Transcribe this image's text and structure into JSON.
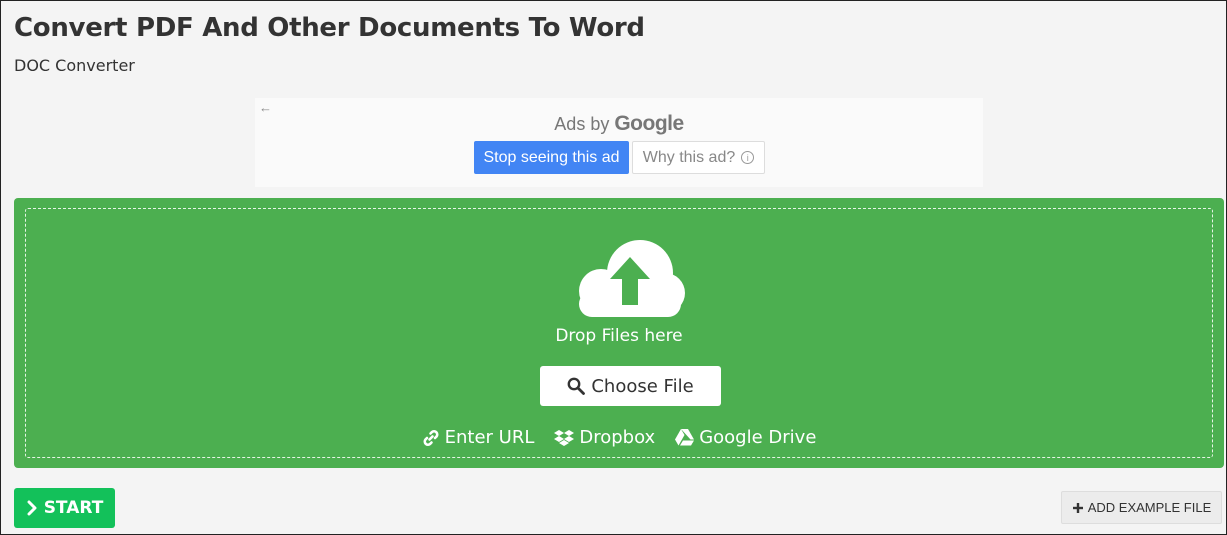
{
  "header": {
    "title": "Convert PDF And Other Documents To Word",
    "subtitle": "DOC Converter"
  },
  "ad": {
    "back_icon": "arrow-left-icon",
    "ads_by": "Ads by",
    "google": "Google",
    "stop_label": "Stop seeing this ad",
    "why_label": "Why this ad?",
    "stop_color": "#4285f4"
  },
  "dropzone": {
    "color": "#4caf50",
    "upload_icon": "cloud-upload-icon",
    "drop_text": "Drop Files here",
    "choose_label": "Choose File",
    "sources": [
      {
        "icon": "link-icon",
        "label": "Enter URL"
      },
      {
        "icon": "dropbox-icon",
        "label": "Dropbox"
      },
      {
        "icon": "google-drive-icon",
        "label": "Google Drive"
      }
    ]
  },
  "actions": {
    "start_label": "START",
    "start_color": "#13c15a",
    "example_label": "ADD EXAMPLE FILE"
  }
}
